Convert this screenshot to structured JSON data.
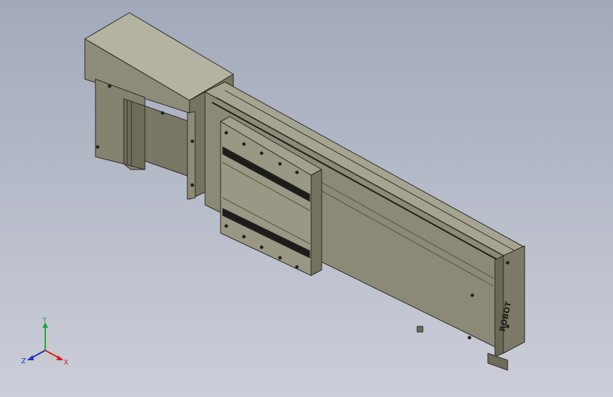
{
  "viewport": {
    "background_top": "#a2a9bb",
    "background_bottom": "#cbced8"
  },
  "model": {
    "body_color": "#8c8a76",
    "edge_color": "#2a2a26",
    "slot_color": "#1c1c1a",
    "end_cap_logo": "ROBOT"
  },
  "triad": {
    "x_label": "X",
    "y_label": "Y",
    "z_label": "Z",
    "x_color": "#d0201e",
    "y_color": "#1ea838",
    "z_color": "#1e2fc8"
  }
}
